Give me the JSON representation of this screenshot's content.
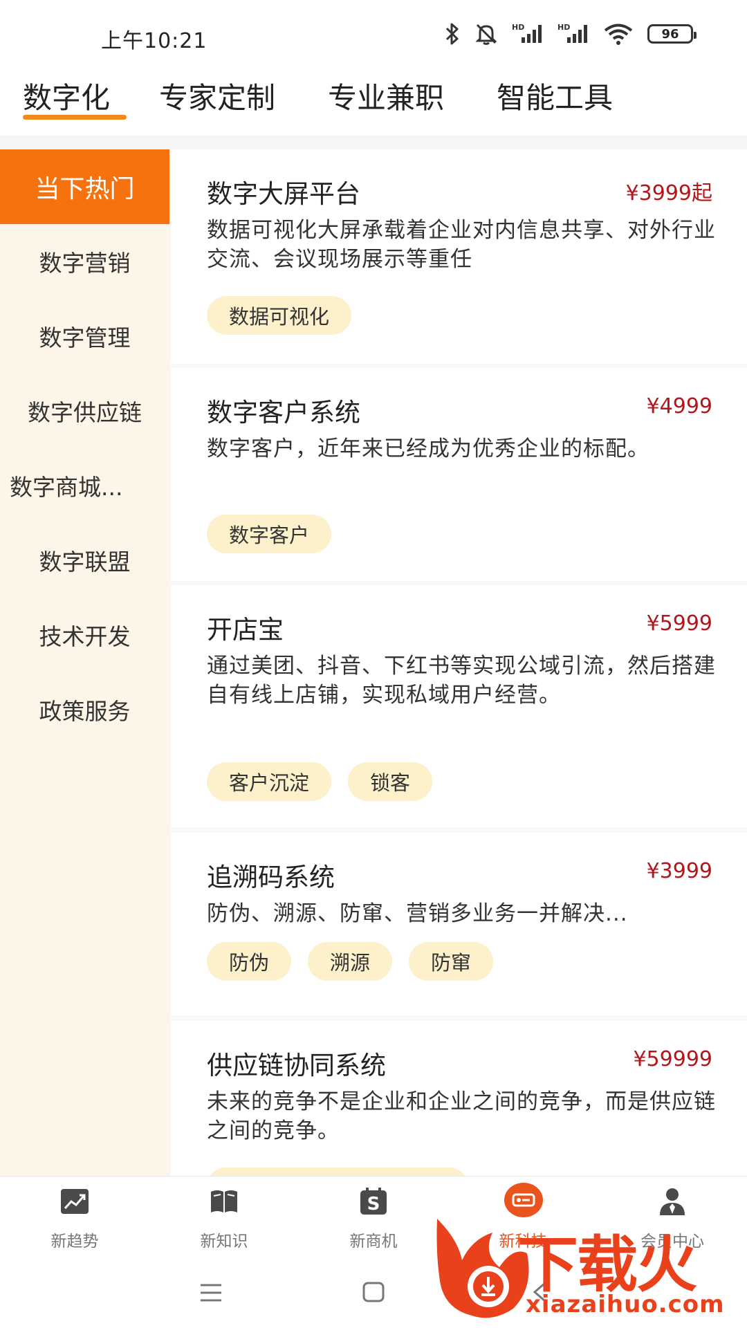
{
  "status_bar": {
    "time": "上午10:21",
    "battery": "96",
    "icons": [
      "bluetooth-icon",
      "mute-icon",
      "signal-hd-icon",
      "signal-hd-icon",
      "wifi-icon",
      "battery-icon"
    ]
  },
  "top_tabs": [
    {
      "label": "数字化",
      "active": true
    },
    {
      "label": "专家定制",
      "active": false
    },
    {
      "label": "专业兼职",
      "active": false
    },
    {
      "label": "智能工具",
      "active": false
    }
  ],
  "sidebar": {
    "items": [
      {
        "label": "当下热门",
        "active": true
      },
      {
        "label": "数字营销"
      },
      {
        "label": "数字管理"
      },
      {
        "label": "数字供应链"
      },
      {
        "label": "数字商城..."
      },
      {
        "label": "数字联盟"
      },
      {
        "label": "技术开发"
      },
      {
        "label": "政策服务"
      }
    ]
  },
  "products": [
    {
      "title": "数字大屏平台",
      "price": "¥3999起",
      "desc": "数据可视化大屏承载着企业对内信息共享、对外行业交流、会议现场展示等重任",
      "tags": [
        "数据可视化"
      ]
    },
    {
      "title": "数字客户系统",
      "price": "¥4999",
      "desc": "数字客户，近年来已经成为优秀企业的标配。",
      "tags": [
        "数字客户"
      ]
    },
    {
      "title": "开店宝",
      "price": "¥5999",
      "desc": "通过美团、抖音、下红书等实现公域引流，然后搭建自有线上店铺，实现私域用户经营。",
      "tags": [
        "客户沉淀",
        "锁客"
      ]
    },
    {
      "title": "追溯码系统",
      "price": "¥3999",
      "desc": "防伪、溯源、防窜、营销多业务一并解决...",
      "tags": [
        "防伪",
        "溯源",
        "防窜"
      ]
    },
    {
      "title": "供应链协同系统",
      "price": "¥59999",
      "desc": "未来的竞争不是企业和企业之间的竞争，而是供应链之间的竞争。",
      "tags": []
    }
  ],
  "bottom_nav": [
    {
      "label": "新趋势",
      "icon": "trend-icon"
    },
    {
      "label": "新知识",
      "icon": "book-icon"
    },
    {
      "label": "新商机",
      "icon": "business-icon"
    },
    {
      "label": "新科技",
      "icon": "tech-icon",
      "active": true
    },
    {
      "label": "会员中心",
      "icon": "member-icon"
    }
  ],
  "watermark": {
    "text": "下载火",
    "url": "xiazaihuo.com"
  },
  "colors": {
    "accent": "#f5720e",
    "price": "#b3171c",
    "tag_bg": "#fdf1cc",
    "sidebar_bg": "#fdf6e8"
  }
}
